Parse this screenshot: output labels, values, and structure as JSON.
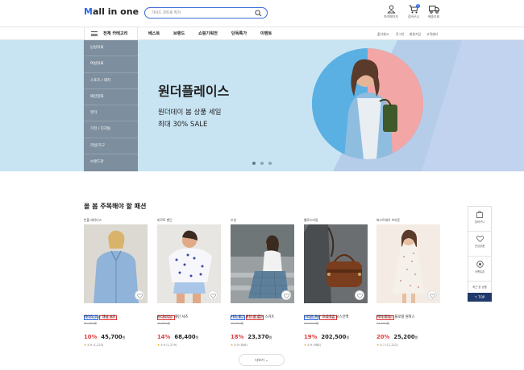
{
  "header": {
    "logo_m": "M",
    "logo_rest": "all in one",
    "search_placeholder": "가이드 코트로 특가",
    "icons": [
      {
        "name": "mypage",
        "label": "마이페이지",
        "icon": "person-icon"
      },
      {
        "name": "cart",
        "label": "장바구니",
        "icon": "cart-icon",
        "badge": "0"
      },
      {
        "name": "delivery",
        "label": "배송조회",
        "icon": "truck-icon"
      }
    ]
  },
  "nav": {
    "category_label": "전체 카테고리",
    "links": [
      "베스트",
      "브랜드",
      "쇼핑기획전",
      "단독특가",
      "이벤트"
    ],
    "util_links": [
      "출석체크",
      "로그인",
      "회원가입",
      "고객센터"
    ]
  },
  "side_menu": [
    "남성의류",
    "여성의류",
    "스포츠 / 레저",
    "패션잡화",
    "뷰티",
    "가전 / 디지털",
    "리빙/가구",
    "브랜드관"
  ],
  "banner": {
    "title": "원더플레이스",
    "subtitle1": "원더데이 봄 상품 세일",
    "subtitle2": "최대 30% SALE",
    "dots": 3,
    "active_dot": 0,
    "colors": {
      "bg": "#c8e4f3",
      "circle_left": "#5ab0e3",
      "circle_right": "#f2a6a6"
    }
  },
  "section": {
    "title": "올 봄 주목해야 할 패션",
    "more_label": "더보기 ⌄"
  },
  "products": [
    {
      "brand": "빈폴 레이디스",
      "tags": [
        {
          "t": "무료배송",
          "c": "blue"
        },
        {
          "t": "스마트배송",
          "c": "red"
        }
      ],
      "name": "베이직 옥스 데님 셔츠",
      "orig": "50,800원",
      "disc": "10%",
      "price": "45,700",
      "won": "원",
      "rating": "4.9 (1,223)",
      "img": "denim"
    },
    {
      "brand": "바르토 벤딘",
      "tags": [
        {
          "t": "스마트배송",
          "c": "red"
        }
      ],
      "name": "슬리브리스 패턴 셔츠",
      "orig": "79,600원",
      "disc": "14%",
      "price": "68,400",
      "won": "원",
      "rating": "4.9 (1,279)",
      "img": "pattern"
    },
    {
      "brand": "오션",
      "tags": [
        {
          "t": "무료배송",
          "c": "blue"
        },
        {
          "t": "스마트배송",
          "c": "red"
        }
      ],
      "name": "셔츠 체크 패턴 롱 랩딩 스커트",
      "orig": "28,500원",
      "disc": "18%",
      "price": "23,370",
      "won": "원",
      "rating": "4.9 (846)",
      "img": "skirt"
    },
    {
      "brand": "헬로스타일",
      "tags": [
        {
          "t": "무료배송",
          "c": "blue"
        },
        {
          "t": "스마트배송",
          "c": "red"
        }
      ],
      "name": "브라운 투톤 프리미엄 보스턴백",
      "orig": "250,000원",
      "disc": "19%",
      "price": "202,500",
      "won": "원",
      "rating": "4.9 (988)",
      "img": "bag"
    },
    {
      "brand": "퍼스트레이 브라운",
      "tags": [
        {
          "t": "스마트배송",
          "c": "red"
        }
      ],
      "name": "베버 레이스 플로럴 원피스",
      "orig": "31,500원",
      "disc": "20%",
      "price": "25,200",
      "won": "원",
      "rating": "4.7 (11,222)",
      "img": "dress"
    }
  ],
  "quick_bar": {
    "items": [
      {
        "label": "장바구니",
        "icon": "bag-icon"
      },
      {
        "label": "관심상품",
        "icon": "heart-icon"
      },
      {
        "label": "이벤트존",
        "icon": "coupon-icon"
      }
    ],
    "recent": "최근 본 상품",
    "top": "↑ TOP"
  }
}
